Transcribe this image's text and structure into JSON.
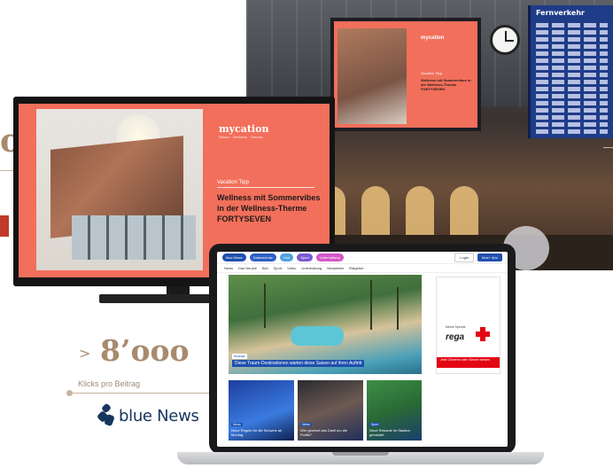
{
  "left_decor": {
    "partial_stat": "o"
  },
  "tv": {
    "brand": "mycation",
    "brand_sub": "Reisen · Wellness · Genuss",
    "tag": "Vacation Tipp",
    "headline": "Wellness mit Sommervibes in der Wellness-Therme FORTYSEVEN"
  },
  "station": {
    "board_title": "Fernverkehr"
  },
  "stats": {
    "arrow": ">",
    "value": "8’ooo",
    "label": "Klicks pro Beitrag",
    "brand": "blue News"
  },
  "laptop_site": {
    "logo": "blue News",
    "pills": [
      "Datenschutz",
      "Live",
      "Sport",
      "Unterhaltung"
    ],
    "nav": [
      "News",
      "Das Neuste",
      "Bild",
      "Sport",
      "Video",
      "Unterhaltung",
      "Newsletter",
      "Ratgeber"
    ],
    "login": "Login",
    "subscribe": "blue+ Abo",
    "hero_badge": "Anzeige",
    "hero_caption": "Diese Traum-Destinationen warten diese Saison auf ihren Auftritt",
    "ad_small": "Meine Spende",
    "ad_brand": "rega",
    "ad_cta": "Jetzt Gönnerin oder Gönner werden",
    "cards": [
      {
        "tag": "News",
        "caption": "Neue Regeln für die Schweiz ab Montag"
      },
      {
        "tag": "News",
        "caption": "Wer gewinnt das Duell um die Politik?"
      },
      {
        "tag": "Sport",
        "caption": "Neue Rekorde im Stadion gemeldet"
      }
    ]
  },
  "colors": {
    "accent_brown": "#a88a6e",
    "coral": "#f26f5b",
    "blue_news": "#17365f",
    "link_blue": "#1f4fae",
    "rega_red": "#e30613"
  }
}
